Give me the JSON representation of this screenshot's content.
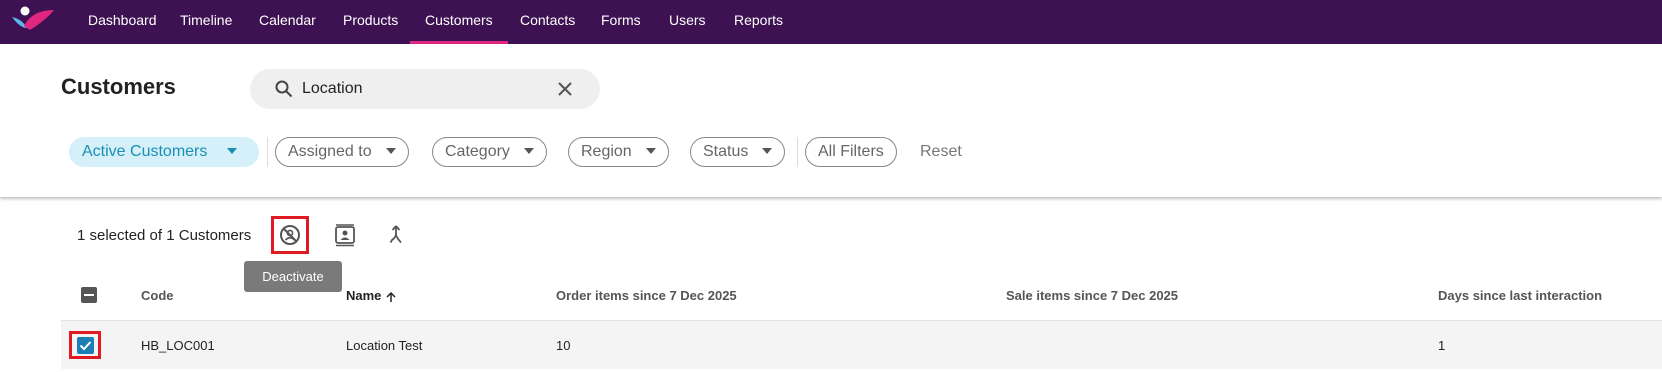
{
  "nav": {
    "items": [
      {
        "label": "Dashboard",
        "active": false
      },
      {
        "label": "Timeline",
        "active": false
      },
      {
        "label": "Calendar",
        "active": false
      },
      {
        "label": "Products",
        "active": false
      },
      {
        "label": "Customers",
        "active": true
      },
      {
        "label": "Contacts",
        "active": false
      },
      {
        "label": "Forms",
        "active": false
      },
      {
        "label": "Users",
        "active": false
      },
      {
        "label": "Reports",
        "active": false
      }
    ],
    "colors": {
      "bar": "#3d1152",
      "active_underline": "#e0267f"
    }
  },
  "page": {
    "title": "Customers"
  },
  "search": {
    "value": "Location"
  },
  "filters": {
    "active_view": "Active Customers",
    "assigned_to": "Assigned to",
    "category": "Category",
    "region": "Region",
    "status": "Status",
    "all_filters": "All Filters",
    "reset": "Reset"
  },
  "toolbar": {
    "selection_text": "1 selected of 1 Customers",
    "tooltip": "Deactivate",
    "icons": [
      "deactivate-icon",
      "contact-card-icon",
      "merge-icon"
    ]
  },
  "table": {
    "columns": {
      "code": "Code",
      "name": "Name",
      "order_items": "Order items since 7 Dec 2025",
      "sale_items": "Sale items since 7 Dec 2025",
      "days_since": "Days since last interaction"
    },
    "sort": {
      "column": "Name",
      "direction": "ascending"
    },
    "header_checkbox": "indeterminate",
    "rows": [
      {
        "selected": true,
        "code": "HB_LOC001",
        "name": "Location Test",
        "order_items": "10",
        "sale_items": "",
        "days_since": "1"
      }
    ]
  }
}
